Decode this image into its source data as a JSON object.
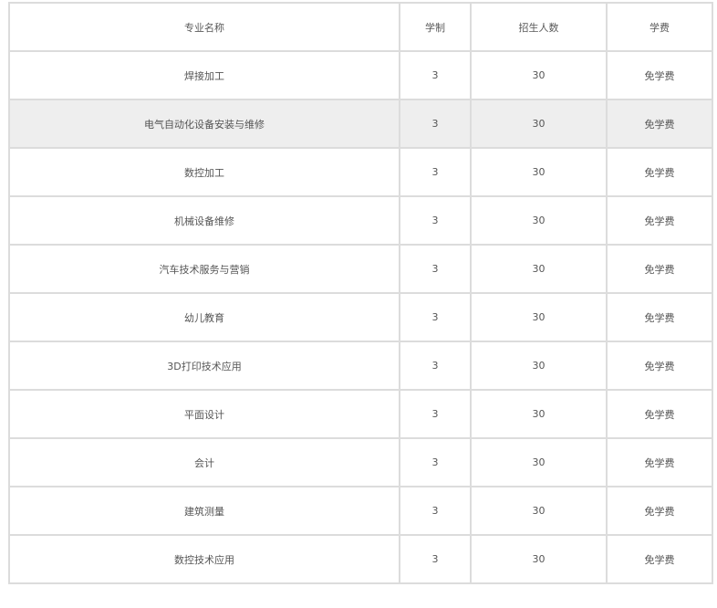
{
  "table": {
    "headers": [
      "专业名称",
      "学制",
      "招生人数",
      "学费"
    ],
    "rows": [
      {
        "name": "焊接加工",
        "years": "3",
        "enrollment": "30",
        "fee": "免学费"
      },
      {
        "name": "电气自动化设备安装与维修",
        "years": "3",
        "enrollment": "30",
        "fee": "免学费",
        "highlighted": true
      },
      {
        "name": "数控加工",
        "years": "3",
        "enrollment": "30",
        "fee": "免学费"
      },
      {
        "name": "机械设备维修",
        "years": "3",
        "enrollment": "30",
        "fee": "免学费"
      },
      {
        "name": "汽车技术服务与营销",
        "years": "3",
        "enrollment": "30",
        "fee": "免学费"
      },
      {
        "name": "幼儿教育",
        "years": "3",
        "enrollment": "30",
        "fee": "免学费"
      },
      {
        "name": "3D打印技术应用",
        "years": "3",
        "enrollment": "30",
        "fee": "免学费"
      },
      {
        "name": "平面设计",
        "years": "3",
        "enrollment": "30",
        "fee": "免学费"
      },
      {
        "name": "会计",
        "years": "3",
        "enrollment": "30",
        "fee": "免学费"
      },
      {
        "name": "建筑测量",
        "years": "3",
        "enrollment": "30",
        "fee": "免学费"
      },
      {
        "name": "数控技术应用",
        "years": "3",
        "enrollment": "30",
        "fee": "免学费"
      }
    ]
  },
  "colors": {
    "border": "#dcdcdc",
    "highlight_row": "#eeeeee",
    "text": "#555555"
  }
}
